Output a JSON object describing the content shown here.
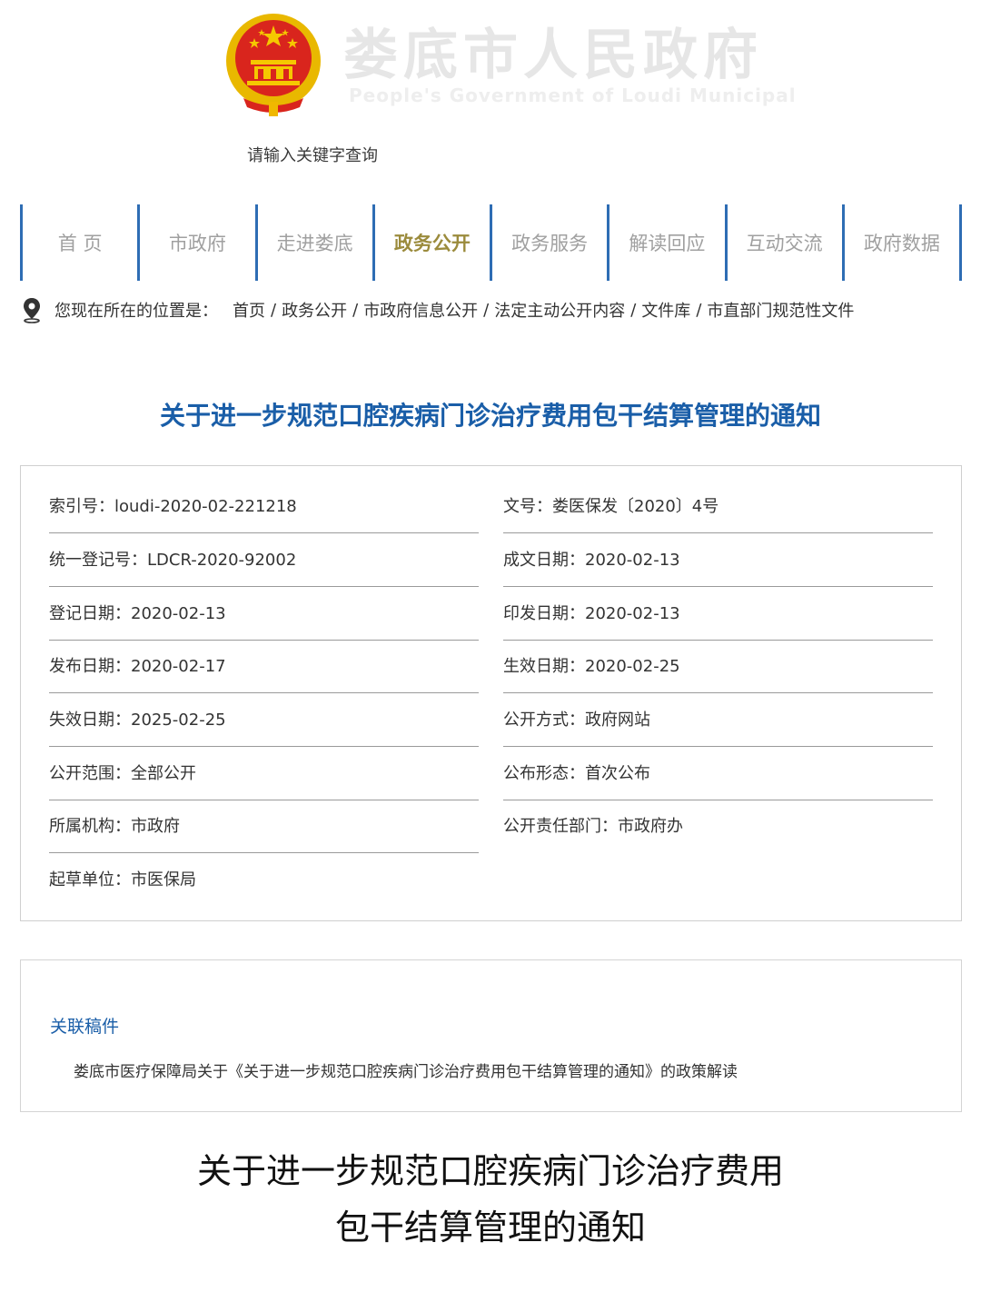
{
  "header": {
    "site_name": "娄底市人民政府",
    "site_subtitle": "People's Government  of Loudi Municipal",
    "search_placeholder": "请输入关键字查询"
  },
  "nav": {
    "items": [
      "首 页",
      "市政府",
      "走进娄底",
      "政务公开",
      "政务服务",
      "解读回应",
      "互动交流",
      "政府数据"
    ],
    "active": "政务公开"
  },
  "breadcrumb": {
    "prefix": "您现在所在的位置是：",
    "items": [
      "首页",
      "政务公开",
      "市政府信息公开",
      "法定主动公开内容",
      "文件库",
      "市直部门规范性文件"
    ]
  },
  "document": {
    "title": "关于进一步规范口腔疾病门诊治疗费用包干结算管理的通知",
    "body_title_line1": "关于进一步规范口腔疾病门诊治疗费用",
    "body_title_line2": "包干结算管理的通知"
  },
  "meta": {
    "left": [
      "索引号：loudi-2020-02-221218",
      "统一登记号：LDCR-2020-92002",
      "登记日期：2020-02-13",
      "发布日期：2020-02-17",
      "失效日期：2025-02-25",
      "公开范围：全部公开",
      "所属机构：市政府",
      "起草单位：市医保局"
    ],
    "right": [
      "文号：娄医保发〔2020〕4号",
      "成文日期：2020-02-13",
      "印发日期：2020-02-13",
      "生效日期：2020-02-25",
      "公开方式：政府网站",
      "公布形态：首次公布",
      "公开责任部门：市政府办"
    ]
  },
  "related": {
    "heading": "关联稿件",
    "items": [
      "娄底市医疗保障局关于《关于进一步规范口腔疾病门诊治疗费用包干结算管理的通知》的政策解读"
    ]
  },
  "colors": {
    "accent_blue": "#1a5ea8",
    "nav_divider": "#2e6db4",
    "nav_active": "#9b8b3c",
    "emblem_red": "#d9251d",
    "emblem_gold": "#f0b800"
  }
}
